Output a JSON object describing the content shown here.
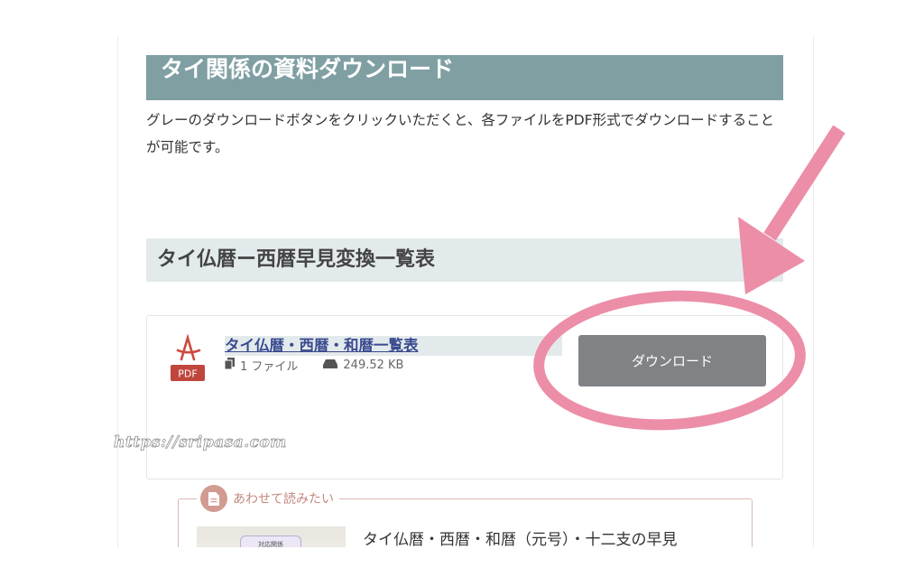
{
  "section": {
    "heading": "タイ関係の資料ダウンロード",
    "intro": "グレーのダウンロードボタンをクリックいただくと、各ファイルをPDF形式でダウンロードすることが可能です。"
  },
  "subsection": {
    "heading": "タイ仏暦ー西暦早見変換一覧表"
  },
  "download_card": {
    "icon_label": "PDF",
    "file_title": "タイ仏暦・西暦・和暦一覧表",
    "file_count": "1 ファイル",
    "file_size": "249.52 KB",
    "button_label": "ダウンロード"
  },
  "related": {
    "label": "あわせて読みたい",
    "thumbnail_text": "対応関係",
    "title": "タイ仏暦・西暦・和暦（元号）・十二支の早見"
  },
  "watermark": "https://sripasa.com",
  "annotation_colors": {
    "arrow": "#ec8ea8",
    "ellipse": "#ec8ea8"
  }
}
